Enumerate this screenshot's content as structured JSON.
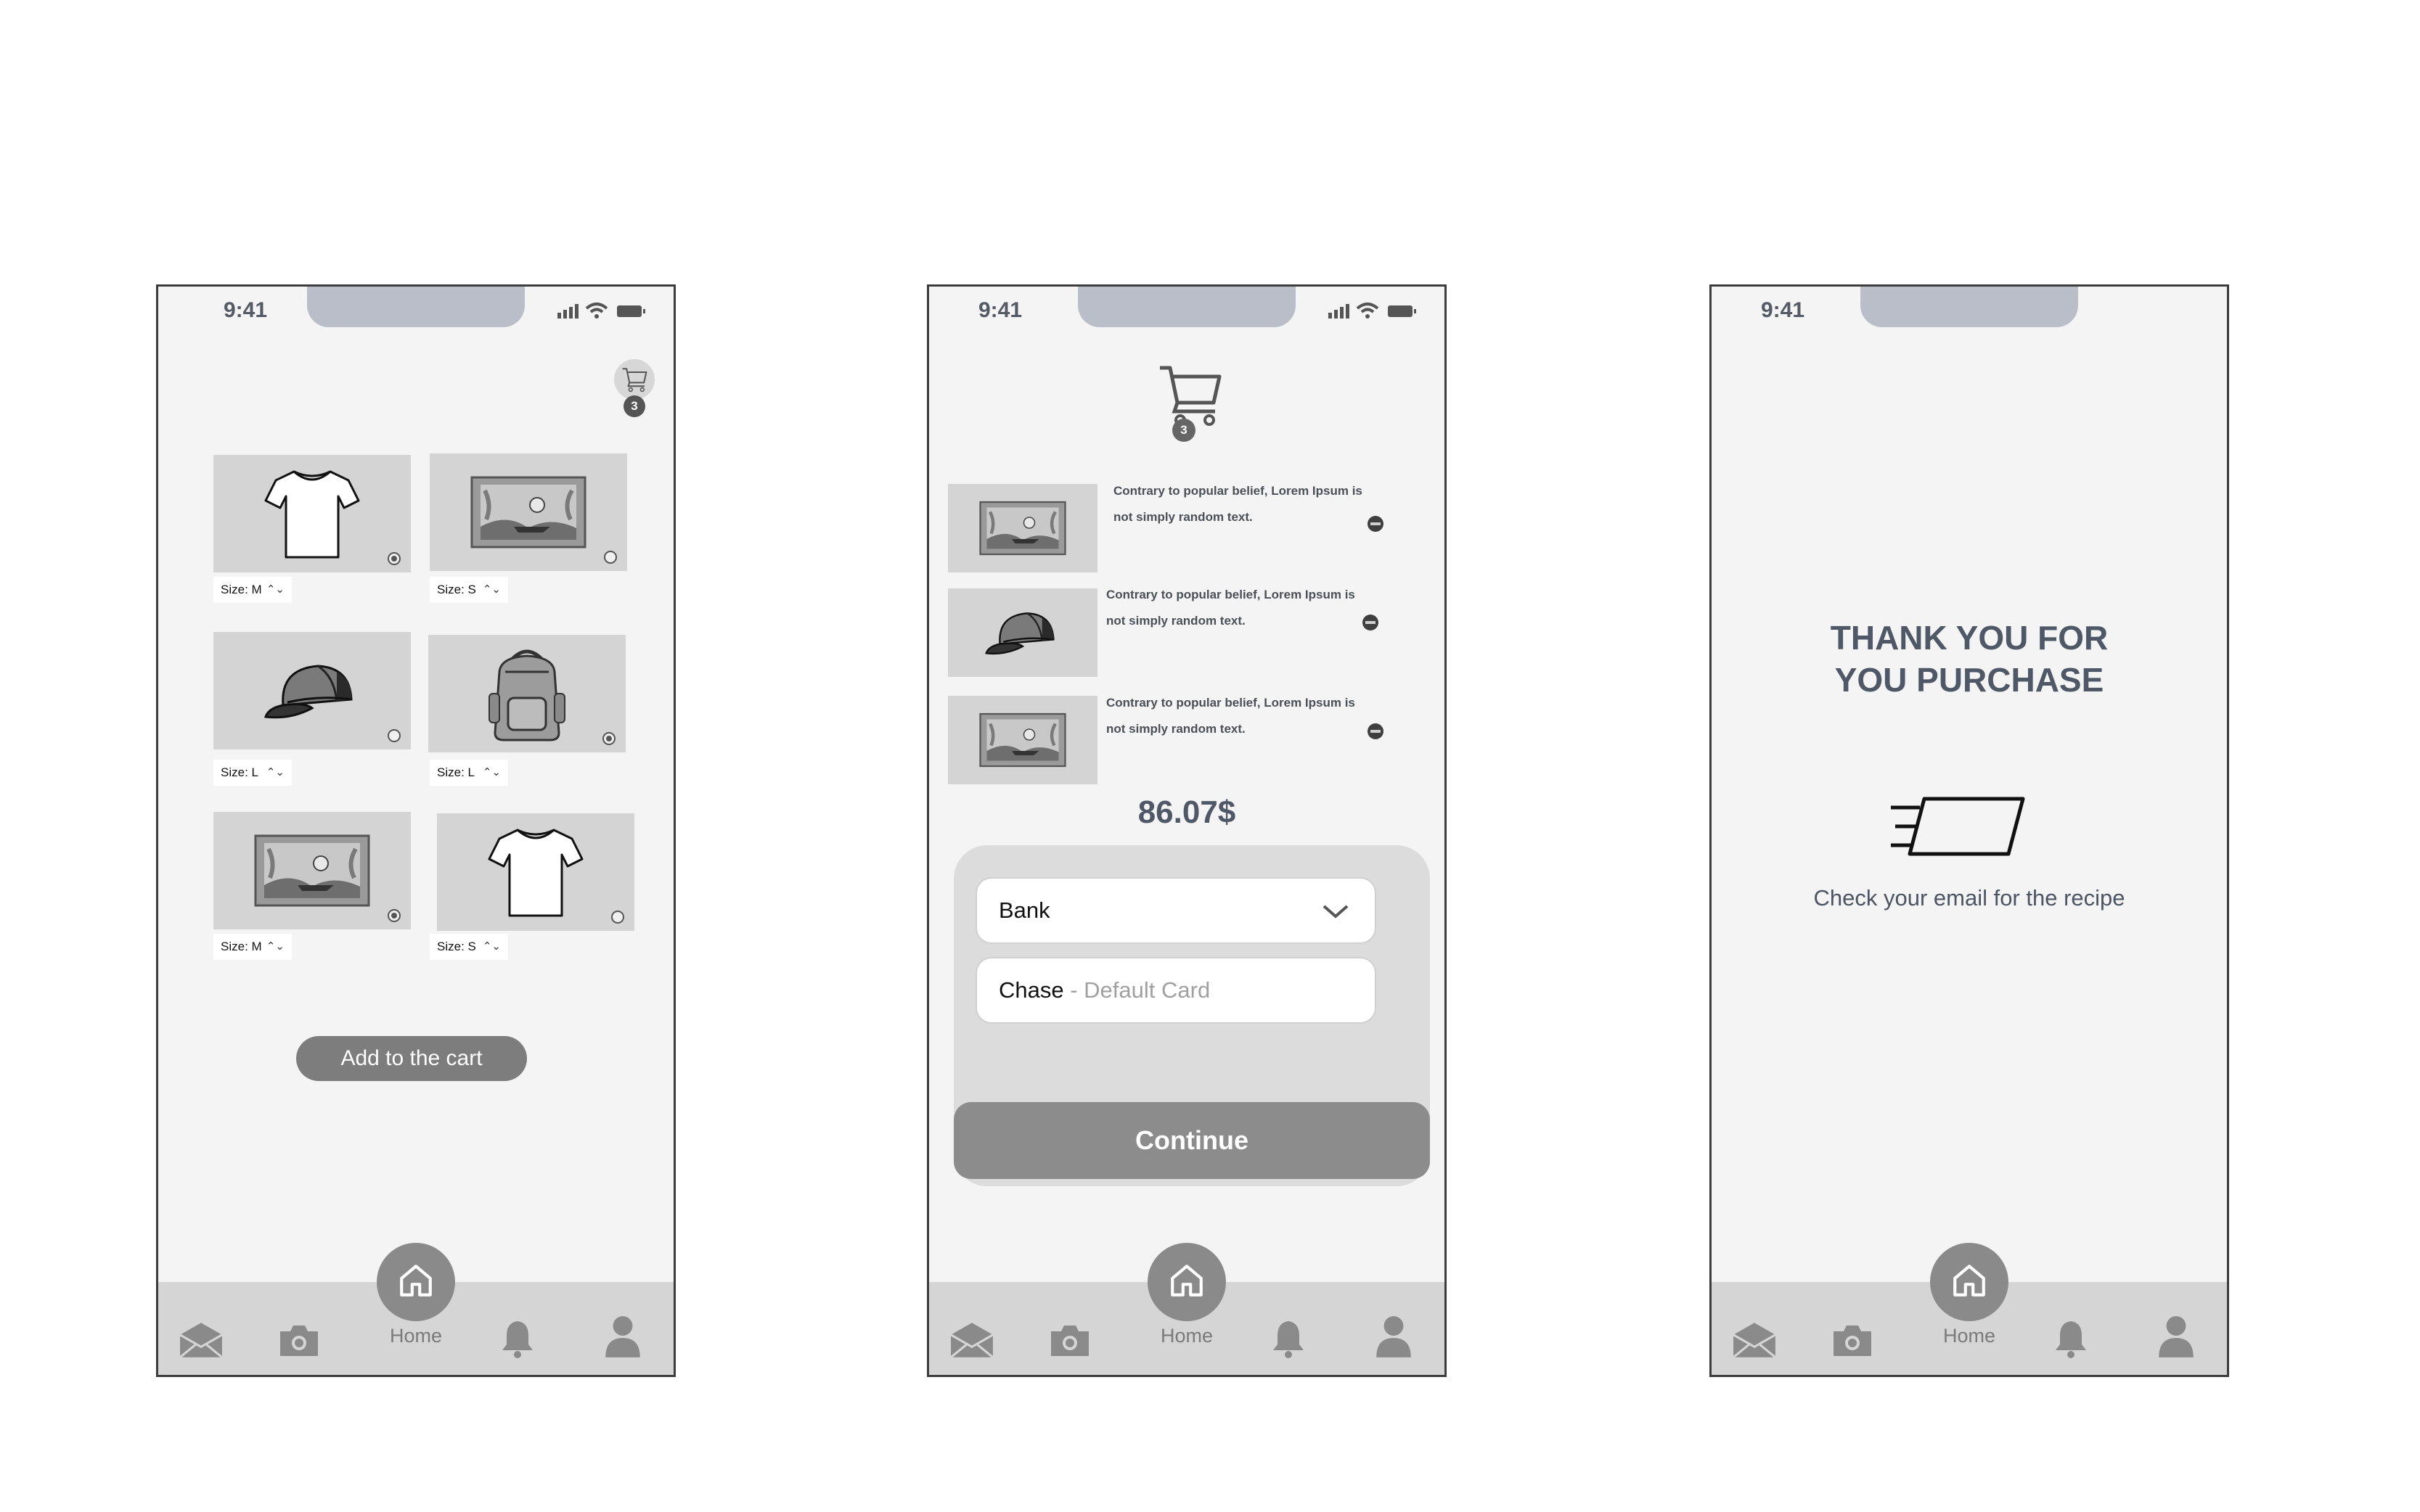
{
  "status_time": "9:41",
  "nav": {
    "home_label": "Home"
  },
  "screen1": {
    "cart_badge": "3",
    "products": [
      {
        "size": "Size: M",
        "selected": true,
        "icon": "tshirt-icon"
      },
      {
        "size": "Size: S",
        "selected": false,
        "icon": "poster-icon"
      },
      {
        "size": "Size: L",
        "selected": false,
        "icon": "cap-icon"
      },
      {
        "size": "Size: L",
        "selected": true,
        "icon": "backpack-icon"
      },
      {
        "size": "Size: M",
        "selected": true,
        "icon": "poster-icon"
      },
      {
        "size": "Size: S",
        "selected": false,
        "icon": "tshirt-icon"
      }
    ],
    "add_to_cart_label": "Add to the cart"
  },
  "screen2": {
    "cart_badge": "3",
    "items": [
      {
        "line1": "Contrary to popular belief, Lorem Ipsum is",
        "line2": "not simply random text.",
        "icon": "poster-icon"
      },
      {
        "line1": "Contrary to popular belief, Lorem Ipsum is",
        "line2": "not simply random text.",
        "icon": "cap-icon"
      },
      {
        "line1": "Contrary to popular belief, Lorem Ipsum is",
        "line2": "not simply random text.",
        "icon": "poster-icon"
      }
    ],
    "total": "86.07$",
    "bank_select": "Bank",
    "card_name": "Chase",
    "card_suffix": " - Default Card",
    "continue_label": "Continue"
  },
  "screen3": {
    "thanks_line1": "THANK YOU FOR",
    "thanks_line2": "YOU PURCHASE",
    "email_note": "Check your email for the recipe"
  },
  "colors": {
    "nav_bg": "#d5d5d5",
    "accent_gray": "#8c8c8c",
    "heading": "#4f5867"
  }
}
